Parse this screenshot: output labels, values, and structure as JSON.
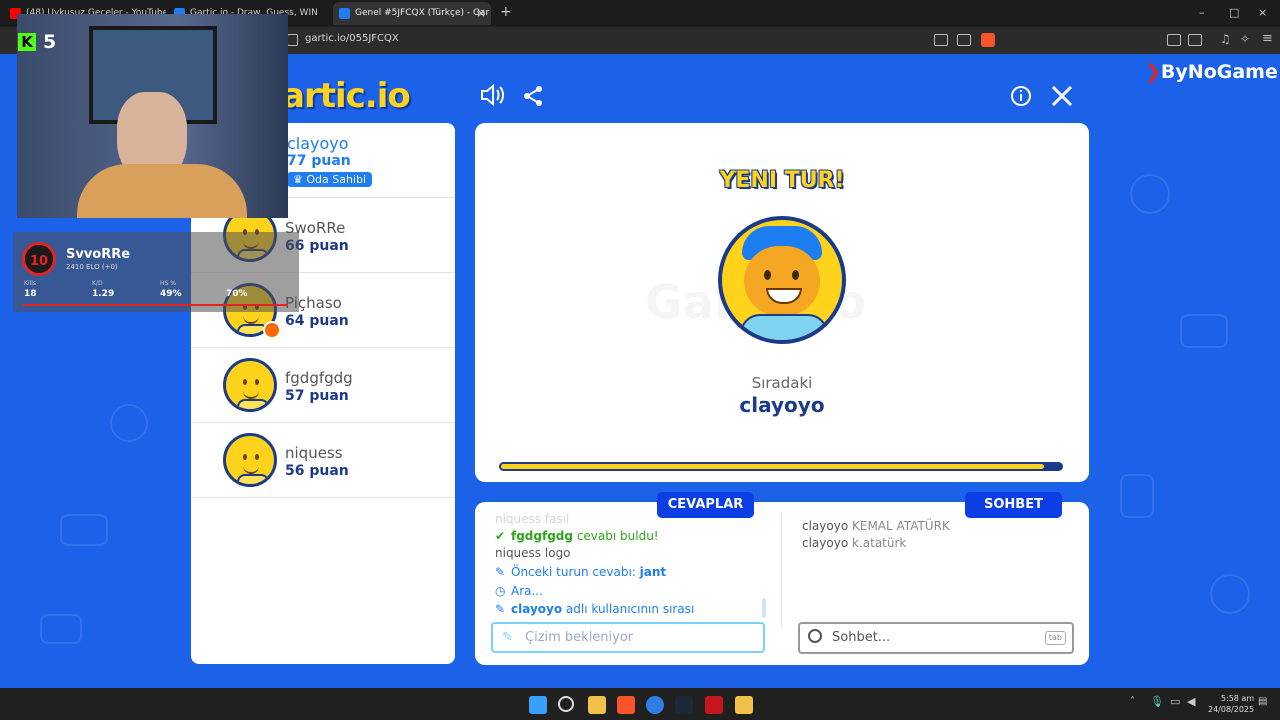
{
  "browser": {
    "tabs": [
      {
        "label": "(48) Uykusuz Geceler - YouTube",
        "favicon_color": "#ff0000",
        "active": false
      },
      {
        "label": "Gartic.io - Draw, Guess, WIN",
        "favicon_color": "#1e7df0",
        "active": false
      },
      {
        "label": "Genel #5JFCQX (Türkçe) - Gar",
        "favicon_color": "#1e7df0",
        "active": true
      }
    ],
    "new_tab": "+",
    "tab_close": "×",
    "url": "gartic.io/055JFCQX",
    "window_controls": [
      "–",
      "□",
      "×"
    ]
  },
  "header": {
    "logo": "artic.io",
    "sound_icon": "speaker-icon",
    "share_icon": "share-icon",
    "info_icon": "info-icon",
    "close_icon": "close-icon"
  },
  "players": [
    {
      "name": "clayoyo",
      "points": "77 puan",
      "badge": "Oda Sahibi",
      "highlight": true
    },
    {
      "name": "SwoRRe",
      "points": "66 puan"
    },
    {
      "name": "Piçhaso",
      "points": "64 puan"
    },
    {
      "name": "fgdgfgdg",
      "points": "57 puan"
    },
    {
      "name": "niquess",
      "points": "56 puan"
    }
  ],
  "round": {
    "title": "YENI TUR!",
    "next_label": "Sıradaki",
    "next_player": "clayoyo",
    "progress": 0.97,
    "watermark": "Gartic.io"
  },
  "answers": {
    "button": "CEVAPLAR",
    "lines": [
      {
        "icon": "",
        "user": "niquess",
        "text": "fasıl"
      },
      {
        "icon": "check",
        "user": "fgdgfgdg",
        "text": "cevabı buldu!"
      },
      {
        "icon": "",
        "user": "niquess",
        "text": "logo"
      },
      {
        "icon": "pencil",
        "user": "",
        "text": "Önceki turun cevabı:",
        "extra": "jant"
      },
      {
        "icon": "clock",
        "user": "",
        "text": "Ara..."
      },
      {
        "icon": "pencil",
        "user": "clayoyo",
        "text": "adlı kullanıcının sırası"
      }
    ],
    "input_placeholder": "Çizim bekleniyor"
  },
  "chat": {
    "button": "SOHBET",
    "lines": [
      {
        "user": "clayoyo",
        "text": "KEMAL ATATÜRK"
      },
      {
        "user": "clayoyo",
        "text": "k.atatürk"
      }
    ],
    "input_placeholder": "Sohbet...",
    "tab_hint": "tab"
  },
  "overlay": {
    "kick_count": "5",
    "faceit": {
      "level": "10",
      "name": "SvvoRRe",
      "elo": "2410 ELO (+0)",
      "stats": [
        {
          "label": "Kills",
          "value": "18"
        },
        {
          "label": "K/D",
          "value": "1.29"
        },
        {
          "label": "HS %",
          "value": "49%"
        },
        {
          "label": "",
          "value": "70%"
        }
      ]
    },
    "sponsor": "ByNoGame"
  },
  "taskbar": {
    "time": "5:58 am",
    "date": "24/08/2025"
  }
}
